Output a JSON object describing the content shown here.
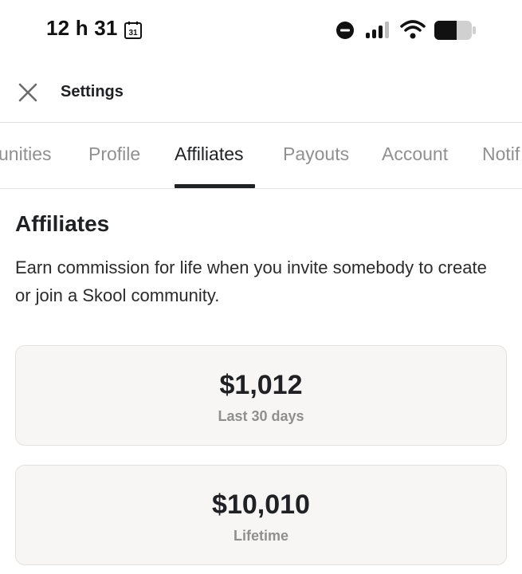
{
  "status_bar": {
    "time": "12 h 31",
    "calendar_day": "31",
    "icons": [
      "calendar-icon",
      "do-not-disturb-icon",
      "signal-icon",
      "wifi-icon",
      "battery-icon"
    ]
  },
  "header": {
    "title": "Settings",
    "close_icon": "close-icon"
  },
  "tabs": [
    {
      "label": "unities",
      "active": false
    },
    {
      "label": "Profile",
      "active": false
    },
    {
      "label": "Affiliates",
      "active": true
    },
    {
      "label": "Payouts",
      "active": false
    },
    {
      "label": "Account",
      "active": false
    },
    {
      "label": "Notif",
      "active": false
    }
  ],
  "affiliates": {
    "title": "Affiliates",
    "description": "Earn commission for life when you invite somebody to create or join a Skool community.",
    "stats": [
      {
        "value": "$1,012",
        "label": "Last 30 days"
      },
      {
        "value": "$10,010",
        "label": "Lifetime"
      }
    ]
  },
  "colors": {
    "text_primary": "#202124",
    "text_muted": "#909090",
    "card_bg": "#f7f6f5",
    "card_border": "#e4e2e0",
    "divider": "#e3e3e3"
  }
}
